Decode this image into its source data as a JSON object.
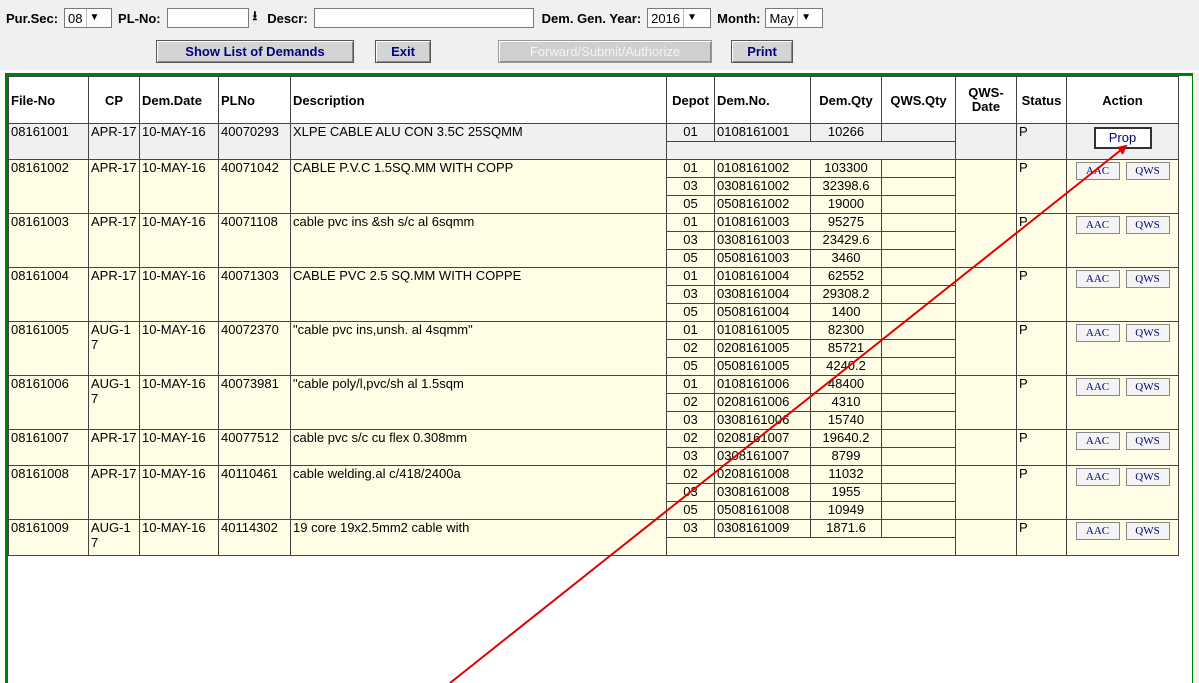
{
  "filters": {
    "pur_sec_label": "Pur.Sec:",
    "pur_sec_value": "08",
    "pl_no_label": "PL-No:",
    "pl_no_value": "",
    "descr_label": "Descr:",
    "descr_value": "",
    "dem_gen_year_label": "Dem. Gen. Year:",
    "dem_gen_year_value": "2016",
    "month_label": "Month:",
    "month_value": "May"
  },
  "buttons": {
    "show_list": "Show List of Demands",
    "exit": "Exit",
    "forward": "Forward/Submit/Authorize",
    "print": "Print"
  },
  "table": {
    "headers": [
      "File-No",
      "CP",
      "Dem.Date",
      "PLNo",
      "Description",
      "Depot",
      "Dem.No.",
      "Dem.Qty",
      "QWS.Qty",
      "QWS-Date",
      "Status",
      "Action"
    ],
    "rows": [
      {
        "file_no": "08161001",
        "cp": "APR-17",
        "date": "10-MAY-16",
        "plno": "40070293",
        "desc": "XLPE CABLE ALU CON 3.5C 25SQMM",
        "status": "P",
        "action": "prop",
        "depots": [
          {
            "depot": "01",
            "dem_no": "0108161001",
            "qty": "10266"
          }
        ]
      },
      {
        "file_no": "08161002",
        "cp": "APR-17",
        "date": "10-MAY-16",
        "plno": "40071042",
        "desc": "CABLE P.V.C 1.5SQ.MM WITH COPP",
        "status": "P",
        "action": "aac",
        "depots": [
          {
            "depot": "01",
            "dem_no": "0108161002",
            "qty": "103300"
          },
          {
            "depot": "03",
            "dem_no": "0308161002",
            "qty": "32398.6"
          },
          {
            "depot": "05",
            "dem_no": "0508161002",
            "qty": "19000"
          }
        ]
      },
      {
        "file_no": "08161003",
        "cp": "APR-17",
        "date": "10-MAY-16",
        "plno": "40071108",
        "desc": "cable pvc ins &sh s/c al 6sqmm",
        "status": "P",
        "action": "aac",
        "depots": [
          {
            "depot": "01",
            "dem_no": "0108161003",
            "qty": "95275"
          },
          {
            "depot": "03",
            "dem_no": "0308161003",
            "qty": "23429.6"
          },
          {
            "depot": "05",
            "dem_no": "0508161003",
            "qty": "3460"
          }
        ]
      },
      {
        "file_no": "08161004",
        "cp": "APR-17",
        "date": "10-MAY-16",
        "plno": "40071303",
        "desc": "CABLE PVC 2.5 SQ.MM WITH COPPE",
        "status": "P",
        "action": "aac",
        "depots": [
          {
            "depot": "01",
            "dem_no": "0108161004",
            "qty": "62552"
          },
          {
            "depot": "03",
            "dem_no": "0308161004",
            "qty": "29308.2"
          },
          {
            "depot": "05",
            "dem_no": "0508161004",
            "qty": "1400"
          }
        ]
      },
      {
        "file_no": "08161005",
        "cp": "AUG-17",
        "date": "10-MAY-16",
        "plno": "40072370",
        "desc": "\"cable pvc ins,unsh. al 4sqmm\"",
        "status": "P",
        "action": "aac",
        "depots": [
          {
            "depot": "01",
            "dem_no": "0108161005",
            "qty": "82300"
          },
          {
            "depot": "02",
            "dem_no": "0208161005",
            "qty": "85721"
          },
          {
            "depot": "05",
            "dem_no": "0508161005",
            "qty": "4240.2"
          }
        ]
      },
      {
        "file_no": "08161006",
        "cp": "AUG-17",
        "date": "10-MAY-16",
        "plno": "40073981",
        "desc": "\"cable poly/l,pvc/sh al 1.5sqm",
        "status": "P",
        "action": "aac",
        "depots": [
          {
            "depot": "01",
            "dem_no": "0108161006",
            "qty": "48400"
          },
          {
            "depot": "02",
            "dem_no": "0208161006",
            "qty": "4310"
          },
          {
            "depot": "03",
            "dem_no": "0308161006",
            "qty": "15740"
          }
        ]
      },
      {
        "file_no": "08161007",
        "cp": "APR-17",
        "date": "10-MAY-16",
        "plno": "40077512",
        "desc": "cable pvc s/c cu flex 0.308mm",
        "status": "P",
        "action": "aac",
        "depots": [
          {
            "depot": "02",
            "dem_no": "0208161007",
            "qty": "19640.2"
          },
          {
            "depot": "03",
            "dem_no": "0308161007",
            "qty": "8799"
          }
        ]
      },
      {
        "file_no": "08161008",
        "cp": "APR-17",
        "date": "10-MAY-16",
        "plno": "40110461",
        "desc": "cable welding.al c/418/2400a",
        "status": "P",
        "action": "aac",
        "depots": [
          {
            "depot": "02",
            "dem_no": "0208161008",
            "qty": "11032"
          },
          {
            "depot": "03",
            "dem_no": "0308161008",
            "qty": "1955"
          },
          {
            "depot": "05",
            "dem_no": "0508161008",
            "qty": "10949"
          }
        ]
      },
      {
        "file_no": "08161009",
        "cp": "AUG-17",
        "date": "10-MAY-16",
        "plno": "40114302",
        "desc": "19 core 19x2.5mm2 cable with",
        "status": "P",
        "action": "aac",
        "depots": [
          {
            "depot": "03",
            "dem_no": "0308161009",
            "qty": "1871.6"
          }
        ]
      }
    ],
    "action_labels": {
      "prop": "Prop",
      "aac": "AAC",
      "qws": "QWS"
    }
  },
  "annotation": {
    "arrow_color": "#e00000"
  }
}
